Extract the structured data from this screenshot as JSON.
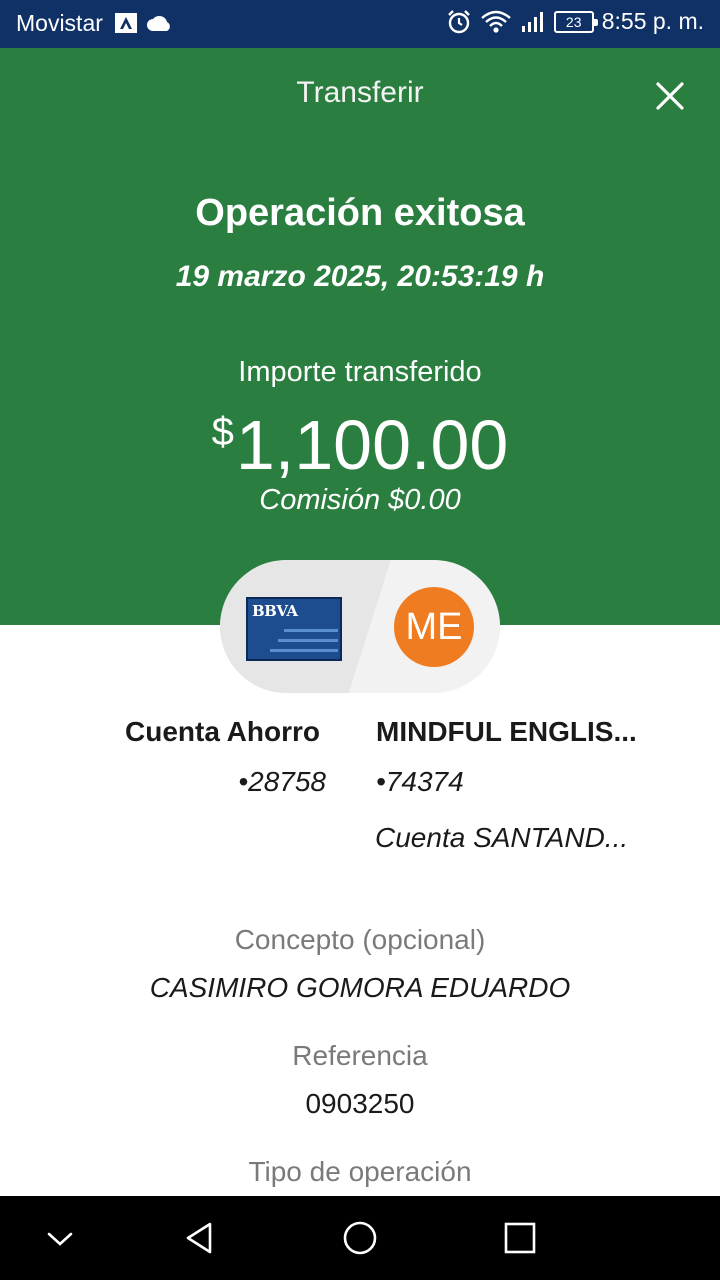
{
  "status_bar": {
    "carrier": "Movistar",
    "battery": "23",
    "time": "8:55 p. m."
  },
  "header": {
    "title": "Transferir",
    "status_title": "Operación exitosa",
    "datetime": "19 marzo 2025, 20:53:19 h",
    "amount_label": "Importe transferido",
    "currency_symbol": "$",
    "amount": "1,100.00",
    "commission": "Comisión  $0.00"
  },
  "cards": {
    "bank_logo_text": "BBVA",
    "avatar_initials": "ME",
    "avatar_color": "#f07c21"
  },
  "origin": {
    "name": "Cuenta Ahorro",
    "number": "•28758"
  },
  "destination": {
    "name": "MINDFUL ENGLIS...",
    "number": "•74374",
    "bank": "Cuenta SANTAND..."
  },
  "details": {
    "concept_label": "Concepto (opcional)",
    "concept_value": "CASIMIRO GOMORA EDUARDO",
    "reference_label": "Referencia",
    "reference_value": "0903250",
    "operation_type_label": "Tipo de operación"
  },
  "colors": {
    "status_bar": "#0f3166",
    "header": "#2a7e40"
  }
}
